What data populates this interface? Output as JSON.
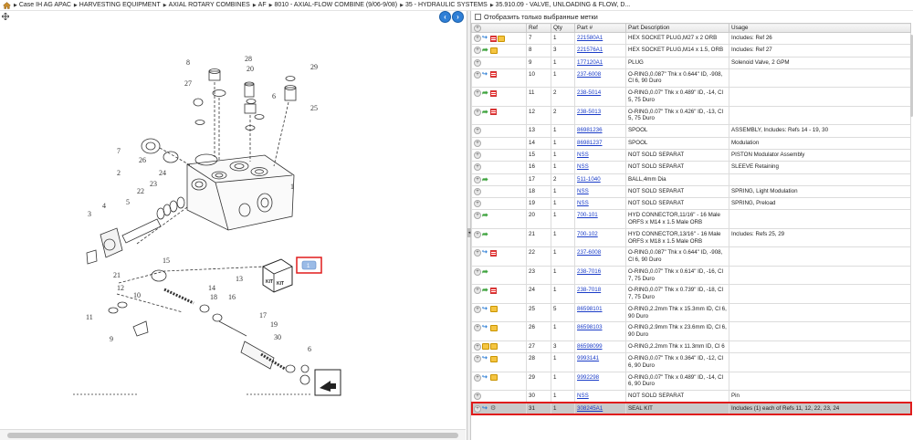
{
  "breadcrumb": {
    "items": [
      "Case IH AG APAC",
      "HARVESTING EQUIPMENT",
      "AXIAL ROTARY COMBINES",
      "AF",
      "8010 - AXIAL-FLOW COMBINE (9/06-9/08)",
      "35 - HYDRAULIC SYSTEMS",
      "35.910.09 - VALVE, UNLOADING & FLOW, D..."
    ]
  },
  "filter": {
    "label": "Отобразить только выбранные метки"
  },
  "table": {
    "headers": [
      "",
      "Ref",
      "Qty",
      "Part #",
      "Part Description",
      "Usage"
    ],
    "rows": [
      {
        "ref": "7",
        "qty": "1",
        "part": "221580A1",
        "desc": "HEX SOCKET PLUG,M27 x 2 ORB",
        "usage": "Includes: Ref 26",
        "icons": [
          "plus",
          "arrowb",
          "doc",
          "box"
        ],
        "tall": false
      },
      {
        "ref": "8",
        "qty": "3",
        "part": "221576A1",
        "desc": "HEX SOCKET PLUG,M14 x 1.5, ORB",
        "usage": "Includes: Ref 27",
        "icons": [
          "plus",
          "arrowg",
          "box"
        ],
        "tall": false
      },
      {
        "ref": "9",
        "qty": "1",
        "part": "177120A1",
        "desc": "PLUG",
        "usage": "Solenoid Valve, 2 GPM",
        "icons": [
          "plus"
        ],
        "tall": false
      },
      {
        "ref": "10",
        "qty": "1",
        "part": "237-6008",
        "desc": "O-RING,0.087\" Thk x 0.644\" ID, -908, Cl 6, 90 Duro",
        "usage": "",
        "icons": [
          "plus",
          "arrowb",
          "doc"
        ],
        "tall": true
      },
      {
        "ref": "11",
        "qty": "2",
        "part": "238-5014",
        "desc": "O-RING,0.07\" Thk x 0.489\" ID, -14, Cl 5, 75 Duro",
        "usage": "",
        "icons": [
          "plus",
          "arrowg",
          "doc"
        ],
        "tall": true
      },
      {
        "ref": "12",
        "qty": "2",
        "part": "238-5013",
        "desc": "O-RING,0.07\" Thk x 0.426\" ID, -13, Cl 5, 75 Duro",
        "usage": "",
        "icons": [
          "plus",
          "arrowg",
          "doc"
        ],
        "tall": true
      },
      {
        "ref": "13",
        "qty": "1",
        "part": "86981236",
        "desc": "SPOOL",
        "usage": "ASSEMBLY, Includes: Refs 14 - 19, 30",
        "icons": [
          "plus"
        ],
        "tall": false
      },
      {
        "ref": "14",
        "qty": "1",
        "part": "86981237",
        "desc": "SPOOL",
        "usage": "Modulation",
        "icons": [
          "plus"
        ],
        "tall": false
      },
      {
        "ref": "15",
        "qty": "1",
        "part": "NSS",
        "desc": "NOT SOLD SEPARAT",
        "usage": "PISTON Modulator Assembly",
        "icons": [
          "plus"
        ],
        "tall": false
      },
      {
        "ref": "16",
        "qty": "1",
        "part": "NSS",
        "desc": "NOT SOLD SEPARAT",
        "usage": "SLEEVE Retaining",
        "icons": [
          "plus"
        ],
        "tall": false
      },
      {
        "ref": "17",
        "qty": "2",
        "part": "511-1040",
        "desc": "BALL,4mm Dia",
        "usage": "",
        "icons": [
          "plus",
          "arrowg"
        ],
        "tall": false
      },
      {
        "ref": "18",
        "qty": "1",
        "part": "NSS",
        "desc": "NOT SOLD SEPARAT",
        "usage": "SPRING, Light Modulation",
        "icons": [
          "plus"
        ],
        "tall": false
      },
      {
        "ref": "19",
        "qty": "1",
        "part": "NSS",
        "desc": "NOT SOLD SEPARAT",
        "usage": "SPRING, Preload",
        "icons": [
          "plus"
        ],
        "tall": false
      },
      {
        "ref": "20",
        "qty": "1",
        "part": "700-101",
        "desc": "HYD CONNECTOR,11/16\" - 16 Male ORFS x M14 x 1.5 Male ORB",
        "usage": "",
        "icons": [
          "plus",
          "arrowg"
        ],
        "tall": true
      },
      {
        "ref": "21",
        "qty": "1",
        "part": "700-102",
        "desc": "HYD CONNECTOR,13/16\" - 16 Male ORFS x M18 x 1.5 Male ORB",
        "usage": "Includes: Refs 25, 29",
        "icons": [
          "plus",
          "arrowg"
        ],
        "tall": true
      },
      {
        "ref": "22",
        "qty": "1",
        "part": "237-6008",
        "desc": "O-RING,0.087\" Thk x 0.644\" ID, -908, Cl 6, 90 Duro",
        "usage": "",
        "icons": [
          "plus",
          "arrowb",
          "doc"
        ],
        "tall": true
      },
      {
        "ref": "23",
        "qty": "1",
        "part": "238-7016",
        "desc": "O-RING,0.07\" Thk x 0.614\" ID, -16, Cl 7, 75 Duro",
        "usage": "",
        "icons": [
          "plus",
          "arrowg"
        ],
        "tall": true
      },
      {
        "ref": "24",
        "qty": "1",
        "part": "238-7018",
        "desc": "O-RING,0.07\" Thk x 0.739\" ID, -18, Cl 7, 75 Duro",
        "usage": "",
        "icons": [
          "plus",
          "arrowg",
          "doc"
        ],
        "tall": true
      },
      {
        "ref": "25",
        "qty": "5",
        "part": "86598101",
        "desc": "O-RING,2.2mm Thk x 15.3mm ID, Cl 6, 90 Duro",
        "usage": "",
        "icons": [
          "plus",
          "arrowb",
          "box"
        ],
        "tall": true
      },
      {
        "ref": "26",
        "qty": "1",
        "part": "86598103",
        "desc": "O-RING,2.9mm Thk x 23.6mm ID, Cl 6, 90 Duro",
        "usage": "",
        "icons": [
          "plus",
          "arrowb",
          "box"
        ],
        "tall": true
      },
      {
        "ref": "27",
        "qty": "3",
        "part": "86598099",
        "desc": "O-RING,2.2mm Thk x 11.3mm ID, Cl 6",
        "usage": "",
        "icons": [
          "plus",
          "box",
          "box"
        ],
        "tall": false
      },
      {
        "ref": "28",
        "qty": "1",
        "part": "9993141",
        "desc": "O-RING,0.07\" Thk x 0.364\" ID, -12, Cl 6, 90 Duro",
        "usage": "",
        "icons": [
          "plus",
          "arrowb",
          "box"
        ],
        "tall": true
      },
      {
        "ref": "29",
        "qty": "1",
        "part": "9992298",
        "desc": "O-RING,0.07\" Thk x 0.489\" ID, -14, Cl 6, 90 Duro",
        "usage": "",
        "icons": [
          "plus",
          "arrowb",
          "box"
        ],
        "tall": true
      },
      {
        "ref": "30",
        "qty": "1",
        "part": "NSS",
        "desc": "NOT SOLD SEPARAT",
        "usage": "Pin",
        "icons": [
          "plus"
        ],
        "tall": false
      },
      {
        "ref": "31",
        "qty": "1",
        "part": "308245A1",
        "desc": "SEAL KIT",
        "usage": "Includes (1) each of Refs 11, 12, 22, 23, 24",
        "icons": [
          "plus",
          "arrowb",
          "wrench"
        ],
        "tall": false,
        "selected": true
      }
    ]
  },
  "diagram": {
    "kit_label": "KIT",
    "highlight_label": "1",
    "callouts": [
      "8",
      "28",
      "20",
      "29",
      "27",
      "6",
      "25",
      "7",
      "26",
      "1",
      "2",
      "4",
      "5",
      "24",
      "23",
      "22",
      "3",
      "21",
      "15",
      "13",
      "12",
      "10",
      "14",
      "18",
      "11",
      "16",
      "9",
      "17",
      "19",
      "30",
      "6"
    ]
  },
  "colors": {
    "highlight": "#e01b1b",
    "link": "#1a3cc8",
    "nav": "#2f7fd6"
  }
}
